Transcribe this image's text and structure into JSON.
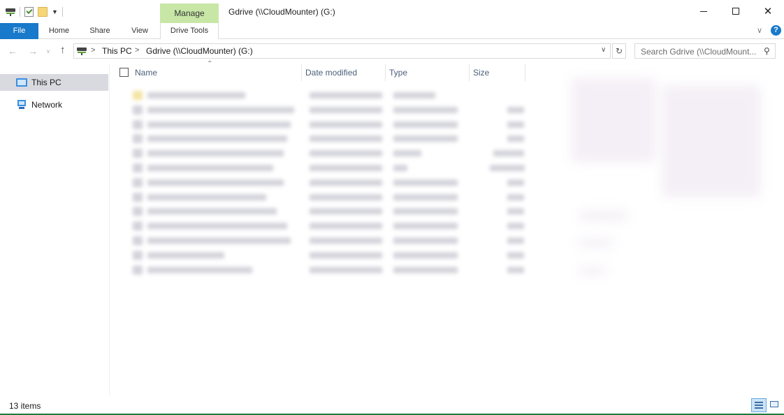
{
  "window": {
    "title": "Gdrive (\\\\CloudMounter) (G:)",
    "context_tab_group": "Manage",
    "controls": {
      "minimize_icon": "minimize-icon",
      "maximize_icon": "maximize-icon",
      "close_icon": "close-icon"
    }
  },
  "quick_access": {
    "icons": [
      "drive-icon",
      "properties-icon",
      "new-folder-icon",
      "customize-dropdown-icon"
    ]
  },
  "ribbon": {
    "tabs": [
      {
        "label": "File",
        "active": false
      },
      {
        "label": "Home",
        "active": false
      },
      {
        "label": "Share",
        "active": false
      },
      {
        "label": "View",
        "active": false
      },
      {
        "label": "Drive Tools",
        "active": true
      }
    ],
    "accent_color": "#1979ca",
    "manage_color": "#c8e7a7"
  },
  "address": {
    "breadcrumbs": [
      "This PC",
      "Gdrive (\\\\CloudMounter) (G:)"
    ],
    "search_placeholder": "Search Gdrive (\\\\CloudMount..."
  },
  "nav_pane": {
    "items": [
      {
        "label": "This PC",
        "selected": true,
        "icon": "computer-icon"
      },
      {
        "label": "Network",
        "selected": false,
        "icon": "network-icon"
      }
    ]
  },
  "file_list": {
    "columns": [
      "Name",
      "Date modified",
      "Type",
      "Size"
    ],
    "sort_column": "Name",
    "rows_blurred": true
  },
  "status": {
    "item_count": "13 items",
    "view_mode": "details"
  }
}
